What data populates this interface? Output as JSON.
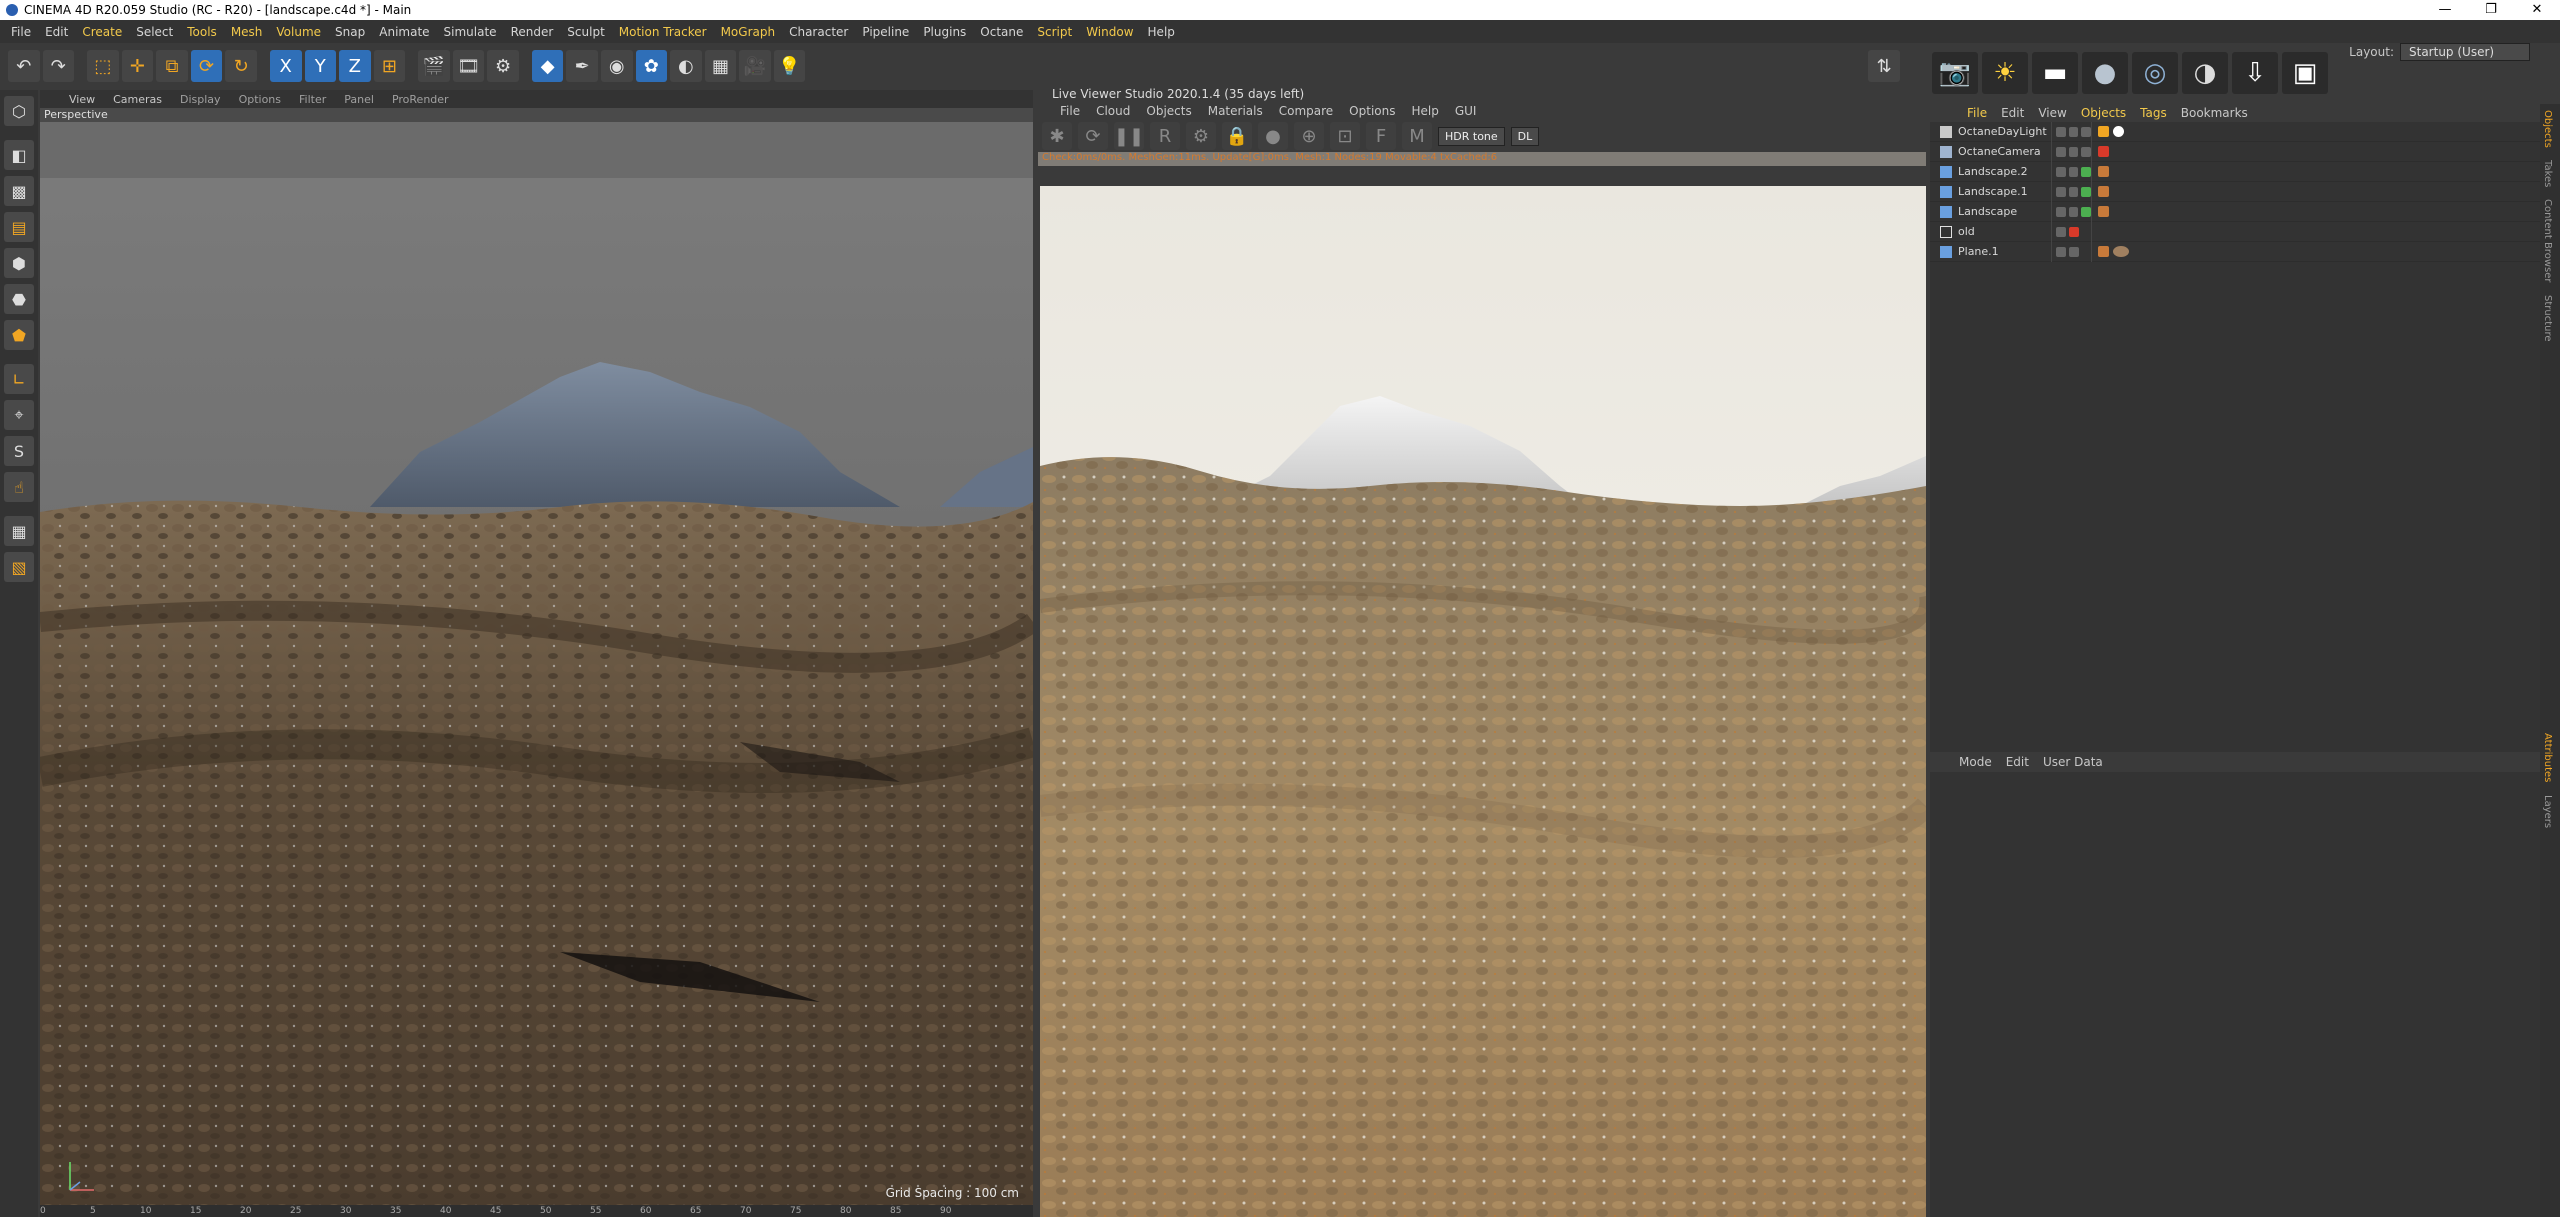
{
  "window": {
    "title": "CINEMA 4D R20.059 Studio (RC - R20) - [landscape.c4d *] - Main",
    "controls": [
      "—",
      "❐",
      "✕"
    ]
  },
  "menubar": {
    "items": [
      "File",
      "Edit",
      "Create",
      "Select",
      "Tools",
      "Mesh",
      "Volume",
      "Snap",
      "Animate",
      "Simulate",
      "Render",
      "Sculpt",
      "Motion Tracker",
      "MoGraph",
      "Character",
      "Pipeline",
      "Plugins",
      "Octane",
      "Script",
      "Window",
      "Help"
    ],
    "layout_label": "Layout:",
    "layout_value": "Startup (User)"
  },
  "toolbar": {
    "undo": "↶",
    "redo": "↷",
    "axis_x": "X",
    "axis_y": "Y",
    "axis_z": "Z"
  },
  "viewport": {
    "menu": [
      "View",
      "Cameras",
      "Display",
      "Options",
      "Filter",
      "Panel",
      "ProRender"
    ],
    "camera_label": "Perspective",
    "grid_spacing": "Grid Spacing : 100 cm"
  },
  "timeline": {
    "ticks": [
      "0",
      "5",
      "10",
      "15",
      "20",
      "25",
      "30",
      "35",
      "40",
      "45",
      "50",
      "55",
      "60",
      "65",
      "70",
      "75",
      "80",
      "85",
      "90"
    ]
  },
  "live_viewer": {
    "title": "Live Viewer Studio 2020.1.4 (35 days left)",
    "menu": [
      "File",
      "Cloud",
      "Objects",
      "Materials",
      "Compare",
      "Options",
      "Help",
      "GUI"
    ],
    "tonemap": "HDR tone",
    "kernel": "DL",
    "status": "Check:0ms/0ms. MeshGen:11ms. Update[G]:0ms. Mesh:1 Nodes:19 Movable:4 txCached:6"
  },
  "object_manager": {
    "menu": [
      "File",
      "Edit",
      "View",
      "Objects",
      "Tags",
      "Bookmarks"
    ],
    "objects": [
      {
        "name": "OctaneDayLight",
        "icon_color": "#c9c9c9",
        "tags": [
          "#f1a623",
          "#ffffff"
        ]
      },
      {
        "name": "OctaneCamera",
        "icon_color": "#9fb4d0",
        "tags": [
          "#d83a2a"
        ]
      },
      {
        "name": "Landscape.2",
        "icon_color": "#6aa0e0",
        "tags": [
          "#c87a3a"
        ]
      },
      {
        "name": "Landscape.1",
        "icon_color": "#6aa0e0",
        "tags": [
          "#c87a3a"
        ]
      },
      {
        "name": "Landscape",
        "icon_color": "#6aa0e0",
        "tags": [
          "#c87a3a"
        ]
      },
      {
        "name": "old",
        "icon_color": "#e0e0e0",
        "tags": []
      },
      {
        "name": "Plane.1",
        "icon_color": "#6aa0e0",
        "tags": [
          "#c87a3a",
          "#a08060"
        ]
      }
    ]
  },
  "attributes": {
    "menu": [
      "Mode",
      "Edit",
      "User Data"
    ]
  },
  "right_tabs": [
    "Objects",
    "Takes",
    "Content Browser",
    "Structure",
    "Attributes",
    "Layers"
  ]
}
